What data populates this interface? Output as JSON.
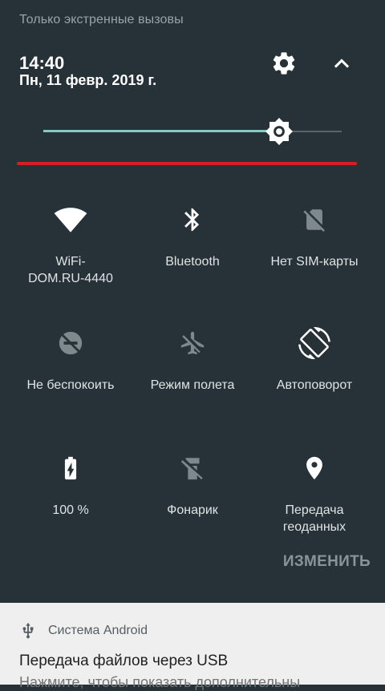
{
  "status": {
    "text": "Только экстренные вызовы"
  },
  "header": {
    "time": "14:40",
    "date": "Пн, 11 февр. 2019 г.",
    "settings_icon": "gear-icon",
    "collapse_icon": "chevron-up-icon"
  },
  "brightness": {
    "level": 0.79
  },
  "colors": {
    "background": "#263238",
    "accent": "#80cbc4",
    "red_line": "#d32027",
    "notification_bg": "#efefef"
  },
  "tiles": [
    {
      "label": "WiFi-\nDOM.RU-4440",
      "icon": "wifi-icon",
      "active": true
    },
    {
      "label": "Bluetooth",
      "icon": "bluetooth-icon",
      "active": true
    },
    {
      "label": "Нет SIM-карты",
      "icon": "no-sim-icon",
      "active": false
    },
    {
      "label": "Не беспокоить",
      "icon": "do-not-disturb-icon",
      "active": false
    },
    {
      "label": "Режим полета",
      "icon": "airplane-icon",
      "active": false
    },
    {
      "label": "Автоповорот",
      "icon": "auto-rotate-icon",
      "active": true
    },
    {
      "label": "100 %",
      "icon": "battery-charging-icon",
      "active": true
    },
    {
      "label": "Фонарик",
      "icon": "flashlight-icon",
      "active": false
    },
    {
      "label": "Передача\nгеоданных",
      "icon": "location-icon",
      "active": true
    }
  ],
  "edit_button": "ИЗМЕНИТЬ",
  "notification": {
    "app": "Система Android",
    "icon": "usb-icon",
    "title": "Передача файлов через USB",
    "text": "Нажмите, чтобы показать дополнительны"
  }
}
